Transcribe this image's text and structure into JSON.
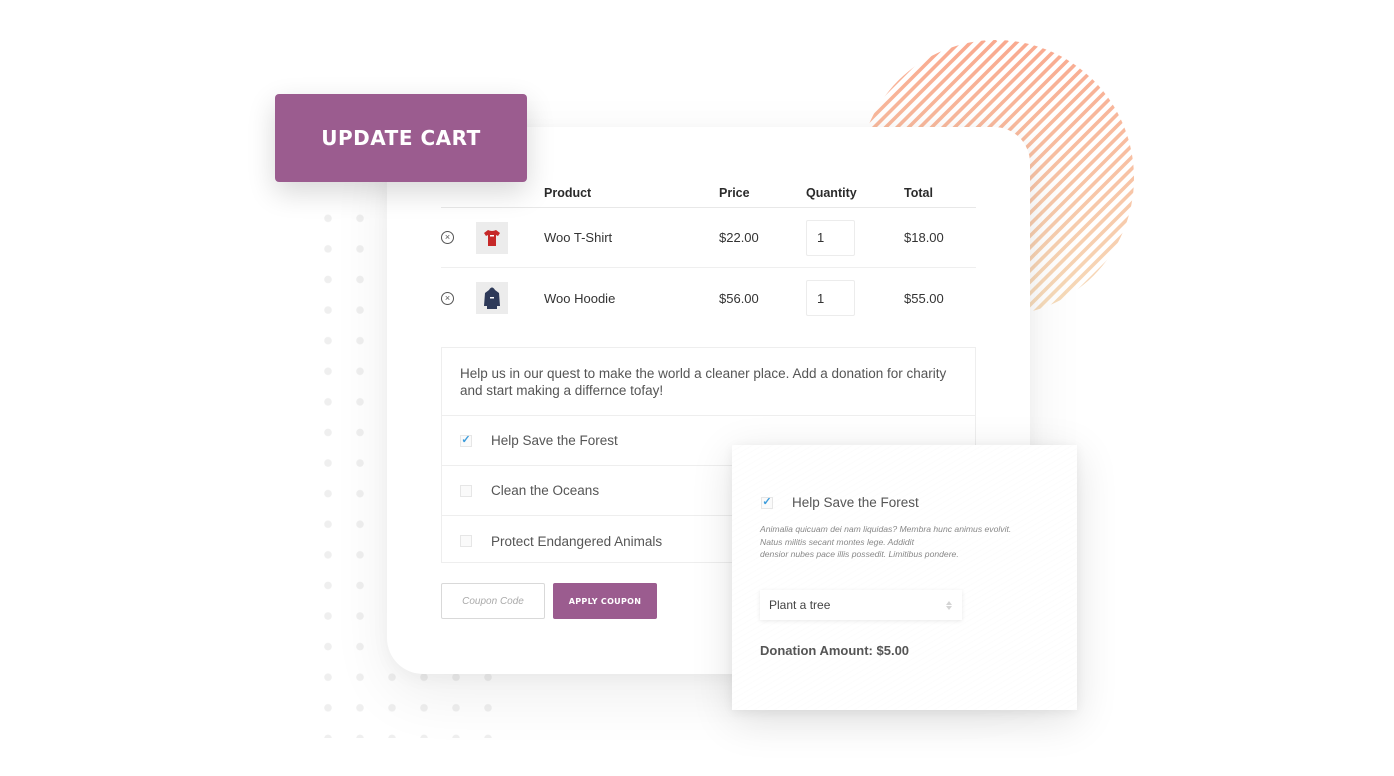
{
  "update_cart_label": "UPDATE CART",
  "cart": {
    "columns": {
      "product": "Product",
      "price": "Price",
      "quantity": "Quantity",
      "total": "Total"
    },
    "rows": [
      {
        "product": "Woo T-Shirt",
        "price": "$22.00",
        "quantity": "1",
        "total": "$18.00",
        "thumb_color": "#c62828",
        "thumb_icon": "tshirt-icon"
      },
      {
        "product": "Woo Hoodie",
        "price": "$56.00",
        "quantity": "1",
        "total": "$55.00",
        "thumb_color": "#2e3a59",
        "thumb_icon": "hoodie-icon"
      }
    ],
    "remove_icon": "remove-circle-x-icon"
  },
  "donation": {
    "intro": "Help us in our quest to make the world a cleaner place. Add a donation for charity and start making a differnce tofay!",
    "options": [
      {
        "label": "Help Save the Forest",
        "checked": true
      },
      {
        "label": "Clean the Oceans",
        "checked": false
      },
      {
        "label": "Protect Endangered Animals",
        "checked": false
      }
    ]
  },
  "coupon": {
    "placeholder": "Coupon Code",
    "value": "",
    "apply_label": "APPLY COUPON"
  },
  "popup": {
    "option_label": "Help Save the Forest",
    "option_checked": true,
    "description": "Animalia quicuam dei nam liquidas? Membra hunc animus evolvit. Natus militis secant montes lege. Addidit densior nubes pace illis possedit. Limitibus pondere.",
    "description_lines": [
      "Animalia quicuam dei nam liquidas? Membra hunc animus evolvit.",
      "Natus militis secant montes lege. Addidit",
      "densior nubes pace illis possedit. Limitibus pondere."
    ],
    "select_value": "Plant a tree",
    "donation_amount_text": "Donation Amount: $5.00"
  },
  "colors": {
    "brand": "#9b5c8f",
    "check": "#3d9cdb",
    "stripe_top": "#f9a98f",
    "stripe_bottom": "#f6e2c0"
  },
  "check_glyph": "✓",
  "remove_glyph": "×"
}
